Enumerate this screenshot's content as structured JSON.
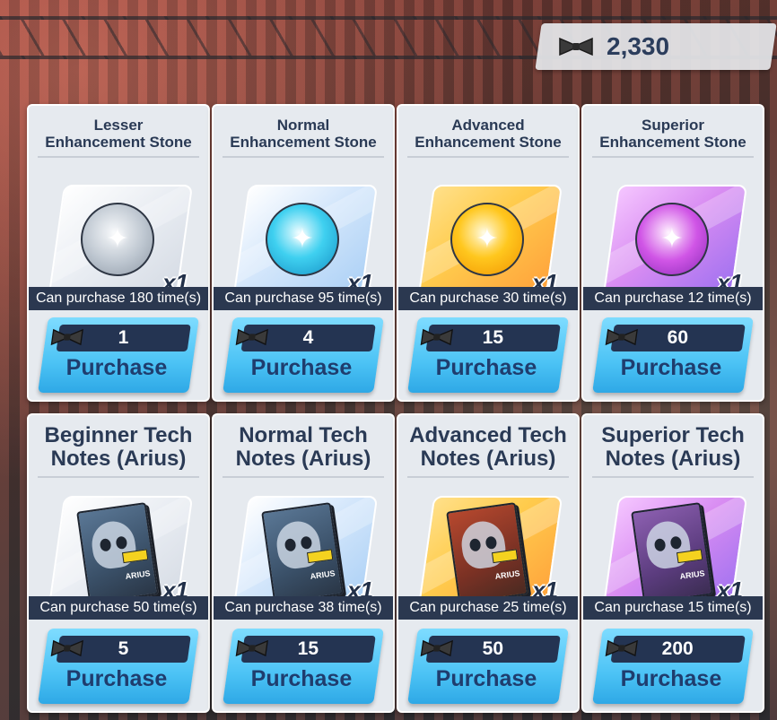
{
  "currency": {
    "icon": "bowtie-icon",
    "amount": "2,330"
  },
  "shop": {
    "items": [
      {
        "title": "Lesser\nEnhancement Stone",
        "art": "gray-enhancement-stone",
        "quantity": "x1",
        "limit": "Can purchase 180 time(s)",
        "price": "1",
        "button": "Purchase"
      },
      {
        "title": "Normal\nEnhancement Stone",
        "art": "blue-enhancement-stone",
        "quantity": "x1",
        "limit": "Can purchase 95 time(s)",
        "price": "4",
        "button": "Purchase"
      },
      {
        "title": "Advanced\nEnhancement Stone",
        "art": "gold-enhancement-stone",
        "quantity": "x1",
        "limit": "Can purchase 30 time(s)",
        "price": "15",
        "button": "Purchase"
      },
      {
        "title": "Superior\nEnhancement Stone",
        "art": "purple-enhancement-stone",
        "quantity": "x1",
        "limit": "Can purchase 12 time(s)",
        "price": "60",
        "button": "Purchase"
      },
      {
        "title": "Beginner Tech\nNotes (Arius)",
        "art": "gray-tech-notes",
        "book_label": "ARIUS",
        "quantity": "x1",
        "limit": "Can purchase 50 time(s)",
        "price": "5",
        "button": "Purchase"
      },
      {
        "title": "Normal Tech\nNotes (Arius)",
        "art": "blue-tech-notes",
        "book_label": "ARIUS",
        "quantity": "x1",
        "limit": "Can purchase 38 time(s)",
        "price": "15",
        "button": "Purchase"
      },
      {
        "title": "Advanced Tech\nNotes (Arius)",
        "art": "gold-tech-notes",
        "book_label": "ARIUS",
        "quantity": "x1",
        "limit": "Can purchase 25 time(s)",
        "price": "50",
        "button": "Purchase"
      },
      {
        "title": "Superior Tech\nNotes (Arius)",
        "art": "purple-tech-notes",
        "book_label": "ARIUS",
        "quantity": "x1",
        "limit": "Can purchase 15 time(s)",
        "price": "200",
        "button": "Purchase"
      }
    ]
  }
}
